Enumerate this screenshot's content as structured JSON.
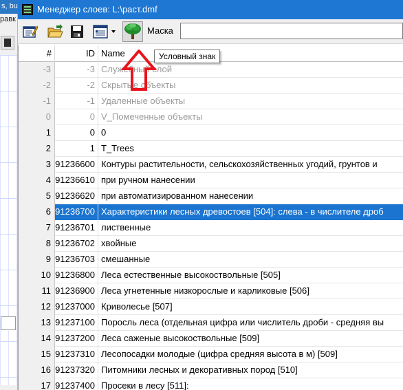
{
  "background_app": {
    "title_fragment": "s, bui",
    "menu_fragment": "равк"
  },
  "window": {
    "title": "Менеджер слоев: L:\\раст.dmf"
  },
  "toolbar": {
    "buttons": [
      {
        "icon": "edit-list-icon"
      },
      {
        "icon": "open-folder-icon"
      },
      {
        "icon": "save-disk-icon"
      },
      {
        "icon": "columns-dropdown-icon"
      },
      {
        "icon": "tree-symbol-icon"
      }
    ],
    "mask_label": "Маска",
    "mask_value": ""
  },
  "tooltip": "Условный знак",
  "columns": {
    "num": "#",
    "id": "ID",
    "name": "Name"
  },
  "rows": [
    {
      "num": "-3",
      "id": "-3",
      "name": "Служебный слой",
      "state": "gray"
    },
    {
      "num": "-2",
      "id": "-2",
      "name": "Скрытые объекты",
      "state": "gray"
    },
    {
      "num": "-1",
      "id": "-1",
      "name": "Удаленные объекты",
      "state": "gray"
    },
    {
      "num": "0",
      "id": "0",
      "name": "V_Помеченные объекты",
      "state": "gray"
    },
    {
      "num": "1",
      "id": "0",
      "name": "0",
      "state": "normal"
    },
    {
      "num": "2",
      "id": "1",
      "name": "T_Trees",
      "state": "normal"
    },
    {
      "num": "3",
      "id": "91236600",
      "name": "Контуры растительности, сельскохозяйственных угодий, грунтов и",
      "state": "normal"
    },
    {
      "num": "4",
      "id": "91236610",
      "name": "при ручном нанесении",
      "state": "normal"
    },
    {
      "num": "5",
      "id": "91236620",
      "name": "при автоматизированном нанесении",
      "state": "normal"
    },
    {
      "num": "6",
      "id": "91236700",
      "name": "Характеристики лесных древостоев [504]: слева - в числителе дроб",
      "state": "selected"
    },
    {
      "num": "7",
      "id": "91236701",
      "name": "лиственные",
      "state": "normal"
    },
    {
      "num": "8",
      "id": "91236702",
      "name": "хвойные",
      "state": "normal"
    },
    {
      "num": "9",
      "id": "91236703",
      "name": "смешанные",
      "state": "normal"
    },
    {
      "num": "10",
      "id": "91236800",
      "name": "Леса естественные высокоствольные [505]",
      "state": "normal"
    },
    {
      "num": "11",
      "id": "91236900",
      "name": "Леса угнетенные низкорослые и карликовые [506]",
      "state": "normal"
    },
    {
      "num": "12",
      "id": "91237000",
      "name": "Криволесье [507]",
      "state": "normal"
    },
    {
      "num": "13",
      "id": "91237100",
      "name": "Поросль леса (отдельная цифра или числитель дроби - средняя вы",
      "state": "normal"
    },
    {
      "num": "14",
      "id": "91237200",
      "name": "Леса саженые высокоствольные [509]",
      "state": "normal"
    },
    {
      "num": "15",
      "id": "91237310",
      "name": "Лесопосадки молодые (цифра средняя высота в м) [509]",
      "state": "normal"
    },
    {
      "num": "16",
      "id": "91237320",
      "name": "Питомники лесных и декоративных пород [510]",
      "state": "normal"
    },
    {
      "num": "17",
      "id": "91237400",
      "name": "Просеки в лесу [511]:",
      "state": "normal"
    }
  ],
  "colors": {
    "titlebar": "#1e77d3",
    "selection": "#1a74d0",
    "annotation_arrow": "#e8141c"
  }
}
